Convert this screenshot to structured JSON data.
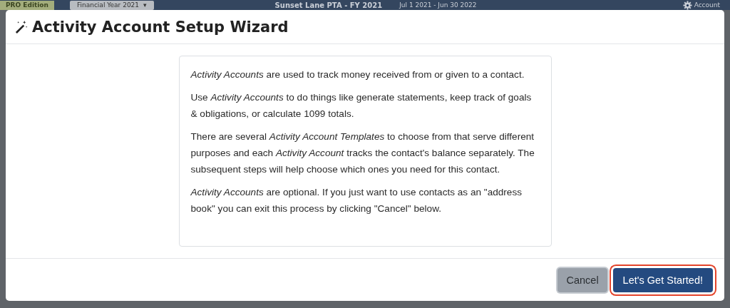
{
  "background_header": {
    "edition_badge": "PRO Edition",
    "year_select": {
      "value": "Financial Year 2021",
      "caret": "▾"
    },
    "organization": "Sunset Lane PTA - FY 2021",
    "period": "Jul 1 2021 - Jun 30 2022",
    "account_menu": "Account"
  },
  "dialog": {
    "title": "Activity Account Setup Wizard",
    "paragraphs": [
      "*Activity Accounts* are used to track money received from or given to a contact.",
      "Use *Activity Accounts* to do things like generate statements, keep track of goals & obligations, or calculate 1099 totals.",
      "There are several *Activity Account Templates* to choose from that serve different purposes and each *Activity Account* tracks the contact's balance separately. The subsequent steps will help choose which ones you need for this contact.",
      "*Activity Accounts* are optional. If you just want to use contacts as an \"address book\" you can exit this process by clicking \"Cancel\" below."
    ],
    "buttons": [
      {
        "label": "Cancel",
        "kind": "secondary",
        "outlined": false
      },
      {
        "label": "Let's Get Started!",
        "kind": "primary",
        "outlined": true
      }
    ]
  }
}
